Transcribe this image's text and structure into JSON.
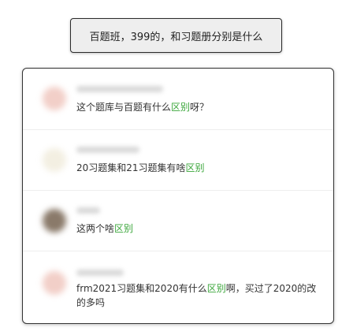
{
  "search": {
    "query": "百题班，399的，和习题册分别是什么"
  },
  "results": [
    {
      "before": "这个题库与百题",
      "mid": "有什么",
      "highlight": "区别",
      "after": "呀？",
      "avatar_color": "#f2cfc8"
    },
    {
      "before": "20习题集和21习题集有啥",
      "mid": "",
      "highlight": "区别",
      "after": "",
      "avatar_color": "#f3efe2"
    },
    {
      "before": "这两个啥",
      "mid": "",
      "highlight": "区别",
      "after": "",
      "avatar_color": "#8a7a6a"
    },
    {
      "before": "frm2021习题集和2020有什么",
      "mid": "",
      "highlight": "区别",
      "after": "啊，买过了2020的改的多吗",
      "avatar_color": "#f2cfc8"
    }
  ]
}
